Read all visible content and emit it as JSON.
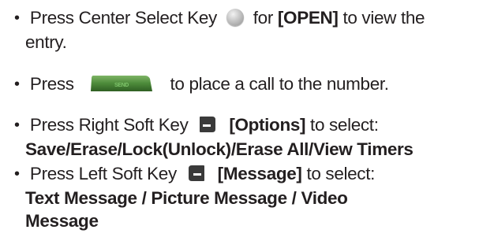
{
  "items": [
    {
      "bullet": "•",
      "pre": "Press Center Select Key",
      "post": "for",
      "bold": "[OPEN]",
      "tail": "to view the",
      "line2": "entry."
    },
    {
      "bullet": "•",
      "pre": "Press",
      "send_label": "SEND",
      "post": "to place a call to the number."
    },
    {
      "bullet": "•",
      "pre": "Press Right Soft Key",
      "bold": "[Options]",
      "post": "to select:",
      "line2": "Save/Erase/Lock(Unlock)/Erase All/View Timers"
    },
    {
      "bullet": "•",
      "pre": "Press Left Soft Key",
      "bold": "[Message]",
      "post": "to select:",
      "line2": "Text Message / Picture Message / Video",
      "line3": "Message"
    }
  ],
  "icons": {
    "center_key": "center-select-key-icon",
    "send_key": "send-key-icon",
    "right_soft_key": "right-soft-key-icon",
    "left_soft_key": "left-soft-key-icon"
  },
  "colors": {
    "text": "#231f20",
    "send_key": "#4c8a3a",
    "soft_key": "#3a3a3a"
  }
}
